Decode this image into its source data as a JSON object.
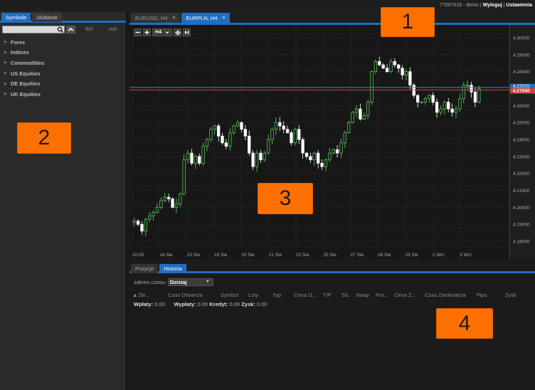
{
  "account": {
    "id_text": "77007016 - demo",
    "logout": "Wyloguj",
    "settings": "Ustawienia"
  },
  "left_panel": {
    "tabs": [
      "Symbole",
      "Ulubione"
    ],
    "columns": {
      "bid": "Bid",
      "ask": "Ask"
    },
    "groups": [
      "Forex",
      "Indices",
      "Commodities",
      "US Equities",
      "DE Equities",
      "UK Equities"
    ]
  },
  "chart_tabs": [
    {
      "label": "EURUSD, H4",
      "active": false
    },
    {
      "label": "EURPLN, H4",
      "active": true
    }
  ],
  "chart_toolbar": {
    "timeframe": "H4"
  },
  "price_labels": {
    "line1": "4.27070",
    "line2": "4.27040"
  },
  "bottom_panel": {
    "tabs": [
      "Pozycje",
      "Historia"
    ],
    "range_label": "zakres czasu:",
    "range_value": "Dzisiaj",
    "columns": [
      "Zle...",
      "Czas Otwarcia",
      "Symbol",
      "Loty",
      "Typ",
      "Cena O...",
      "T/P",
      "S/L",
      "Swap",
      "Pro...",
      "Cena Z...",
      "Czas Zamknięcia",
      "Pips",
      "Zysk"
    ],
    "summary": {
      "wplaty_label": "Wpłaty:",
      "wplaty_val": "0.00",
      "wyplaty_label": "Wypłaty:",
      "wyplaty_val": "0.00",
      "kredyt_label": "Kredyt:",
      "kredyt_val": "0.00",
      "zysk_label": "Zysk:",
      "zysk_val": "0.00"
    }
  },
  "markers": [
    "1",
    "2",
    "3",
    "4"
  ],
  "colors": {
    "accent": "#1e6fc2",
    "bull": "#5cd65c",
    "bear": "#ffffff",
    "marker": "#ff7000",
    "ask_line": "#d04040",
    "bid_line": "#4a7fd0"
  },
  "chart_data": {
    "type": "candlestick",
    "symbol": "EURPLN",
    "timeframe": "H4",
    "ylim": [
      4.175,
      4.305
    ],
    "yticks": [
      "4.30000",
      "4.29000",
      "4.28000",
      "4.27000",
      "4.26000",
      "4.25000",
      "4.24000",
      "4.23000",
      "4.22000",
      "4.21000",
      "4.20000",
      "4.19000",
      "4.18000"
    ],
    "xticks": [
      "20:00",
      "14 Sie",
      "15 Sie",
      "16 Sie",
      "20 Sie",
      "21 Sie",
      "22 Sie",
      "25 Sie",
      "27 Sie",
      "28 Sie",
      "29 Sie",
      "2 Wrz",
      "3 Wrz"
    ],
    "bid": 4.2704,
    "ask": 4.2707,
    "close_path": [
      4.192,
      4.19,
      4.186,
      4.193,
      4.195,
      4.197,
      4.2,
      4.204,
      4.206,
      4.205,
      4.2,
      4.202,
      4.208,
      4.228,
      4.232,
      4.226,
      4.23,
      4.226,
      4.236,
      4.24,
      4.246,
      4.248,
      4.242,
      4.238,
      4.236,
      4.244,
      4.248,
      4.25,
      4.246,
      4.242,
      4.232,
      4.224,
      4.232,
      4.228,
      4.232,
      4.24,
      4.246,
      4.25,
      4.248,
      4.246,
      4.244,
      4.238,
      4.246,
      4.24,
      4.232,
      4.23,
      4.228,
      4.232,
      4.226,
      4.224,
      4.228,
      4.232,
      4.234,
      4.232,
      4.238,
      4.244,
      4.25,
      4.256,
      4.258,
      4.252,
      4.254,
      4.262,
      4.28,
      4.286,
      4.284,
      4.282,
      4.28,
      4.286,
      4.284,
      4.282,
      4.278,
      4.28,
      4.272,
      4.266,
      4.262,
      4.262,
      4.264,
      4.266,
      4.262,
      4.256,
      4.258,
      4.262,
      4.258,
      4.256,
      4.258,
      4.264,
      4.272,
      4.272,
      4.268,
      4.262,
      4.27
    ]
  }
}
